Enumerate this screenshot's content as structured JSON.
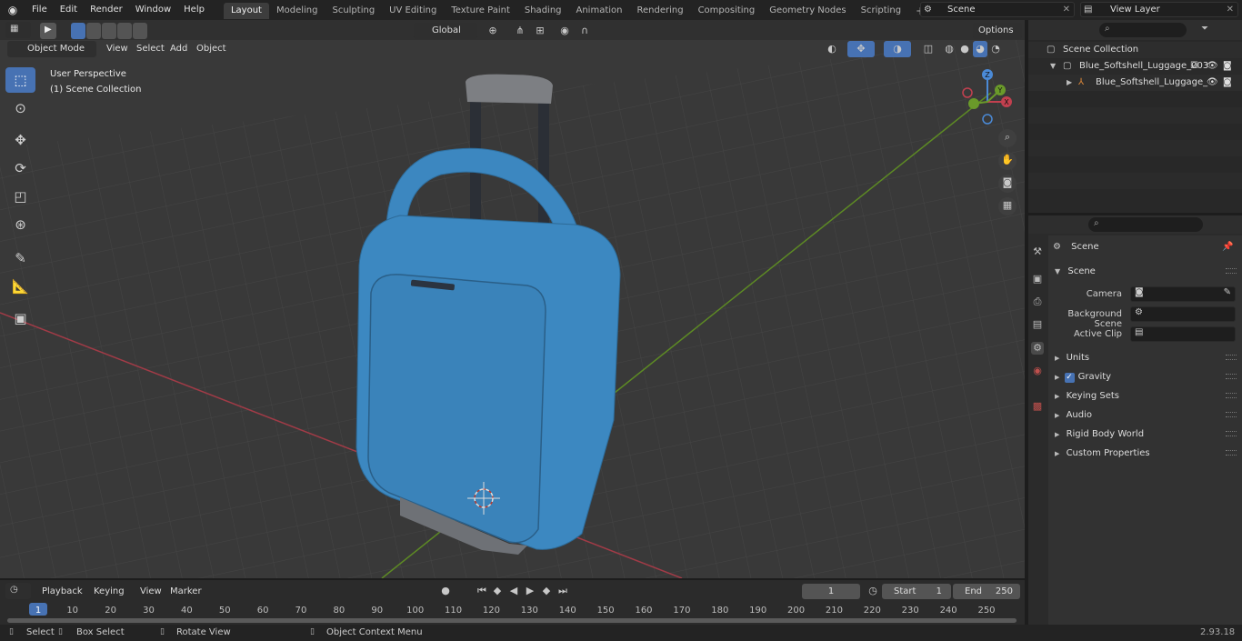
{
  "top_menu": [
    "File",
    "Edit",
    "Render",
    "Window",
    "Help"
  ],
  "workspace_tabs": [
    {
      "label": "Layout",
      "active": true
    },
    {
      "label": "Modeling"
    },
    {
      "label": "Sculpting"
    },
    {
      "label": "UV Editing"
    },
    {
      "label": "Texture Paint"
    },
    {
      "label": "Shading"
    },
    {
      "label": "Animation"
    },
    {
      "label": "Rendering"
    },
    {
      "label": "Compositing"
    },
    {
      "label": "Geometry Nodes"
    },
    {
      "label": "Scripting"
    }
  ],
  "add_workspace": "+",
  "scene_field": "Scene",
  "view_layer_field": "View Layer",
  "viewport_header": {
    "mode": "Object Mode",
    "menus": [
      "View",
      "Select",
      "Add",
      "Object"
    ],
    "transform_orientation": "Global",
    "options": "Options"
  },
  "viewport_overlay": {
    "perspective": "User Perspective",
    "collection": "(1) Scene Collection"
  },
  "gizmo": {
    "x": "X",
    "y": "Y",
    "z": "Z"
  },
  "outliner": {
    "root": "Scene Collection",
    "items": [
      {
        "name": "Blue_Softshell_Luggage_003",
        "level": 1
      },
      {
        "name": "Blue_Softshell_Luggage_",
        "level": 2
      }
    ]
  },
  "properties": {
    "context": "Scene",
    "panel": "Scene",
    "fields": [
      {
        "label": "Camera"
      },
      {
        "label": "Background Scene"
      },
      {
        "label": "Active Clip"
      }
    ],
    "sections": [
      "Units",
      "Gravity",
      "Keying Sets",
      "Audio",
      "Rigid Body World",
      "Custom Properties"
    ],
    "gravity_checked": true
  },
  "timeline": {
    "menus": [
      "Playback",
      "Keying",
      "View",
      "Marker"
    ],
    "current_frame": "1",
    "start_label": "Start",
    "start": "1",
    "end_label": "End",
    "end": "250",
    "ticks": [
      "1",
      "10",
      "20",
      "30",
      "40",
      "50",
      "60",
      "70",
      "80",
      "90",
      "100",
      "110",
      "120",
      "130",
      "140",
      "150",
      "160",
      "170",
      "180",
      "190",
      "200",
      "210",
      "220",
      "230",
      "240",
      "250"
    ]
  },
  "status_bar": {
    "select": "Select",
    "box_select": "Box Select",
    "rotate_view": "Rotate View",
    "context_menu": "Object Context Menu",
    "version": "2.93.18"
  },
  "colors": {
    "accent": "#4772b3",
    "luggage": "#3a86bf",
    "x_axis": "#c2404f",
    "y_axis": "#6a9a2a"
  }
}
